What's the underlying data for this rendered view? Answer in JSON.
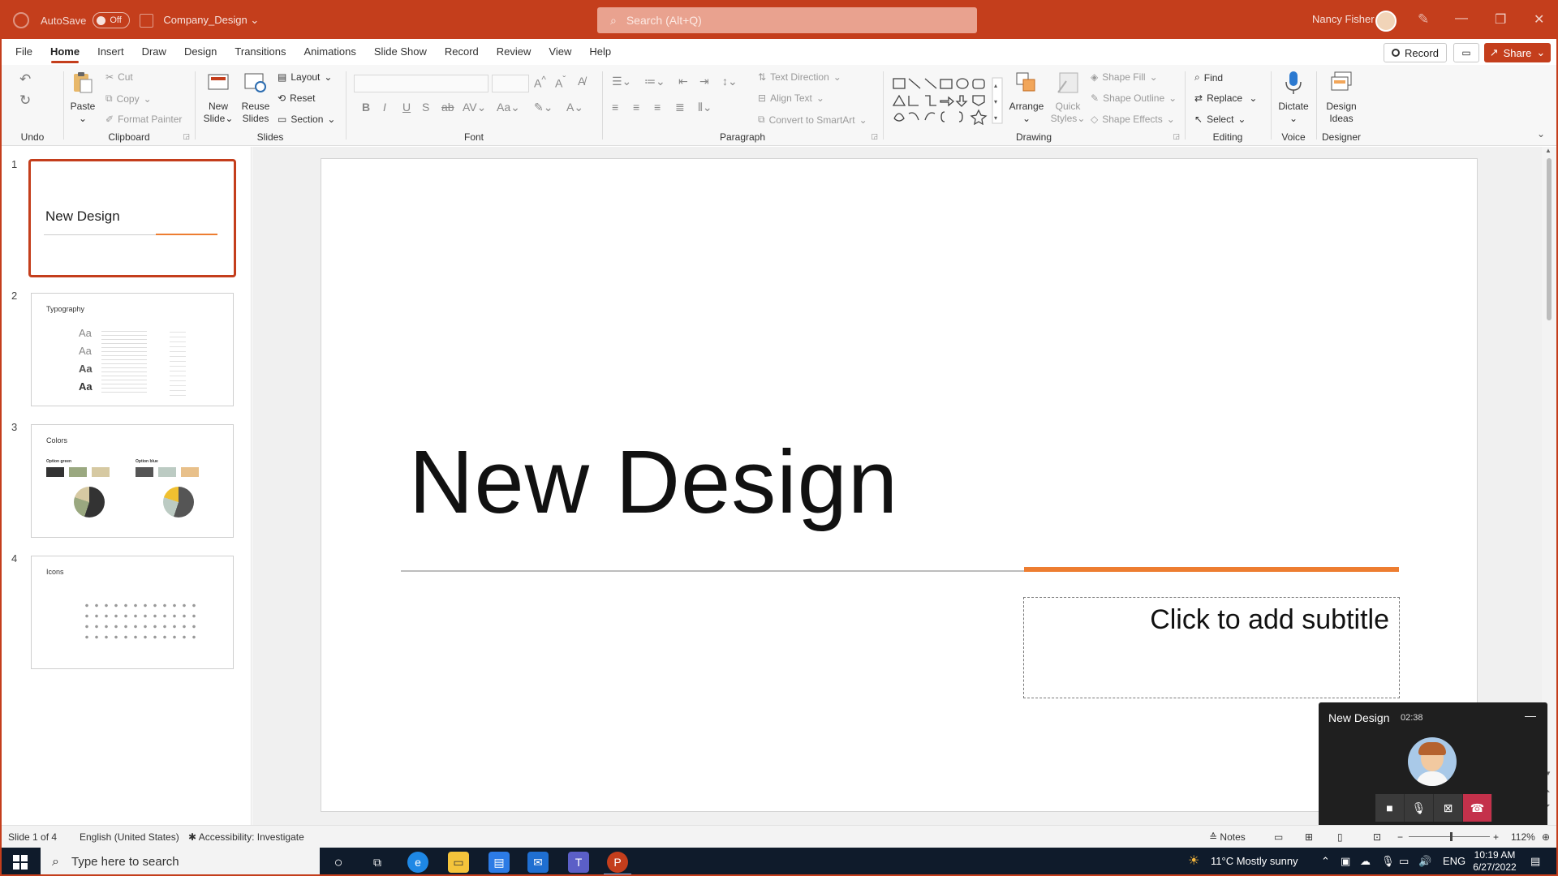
{
  "titlebar": {
    "autosave_label": "AutoSave",
    "autosave_state": "Off",
    "doc_name": "Company_Design",
    "search_placeholder": "Search (Alt+Q)",
    "user_name": "Nancy Fisher",
    "accent": "#c43e1c"
  },
  "menu": {
    "tabs": [
      "File",
      "Home",
      "Insert",
      "Draw",
      "Design",
      "Transitions",
      "Animations",
      "Slide Show",
      "Record",
      "Review",
      "View",
      "Help"
    ],
    "active": "Home",
    "record_label": "Record",
    "share_label": "Share"
  },
  "ribbon": {
    "undo": {
      "group": "Undo"
    },
    "clipboard": {
      "group": "Clipboard",
      "paste": "Paste",
      "cut": "Cut",
      "copy": "Copy",
      "format_painter": "Format Painter"
    },
    "slides": {
      "group": "Slides",
      "new_slide": "New Slide",
      "reuse_slides": "Reuse Slides",
      "layout": "Layout",
      "reset": "Reset",
      "section": "Section"
    },
    "font": {
      "group": "Font"
    },
    "paragraph": {
      "group": "Paragraph",
      "text_direction": "Text Direction",
      "align_text": "Align Text",
      "convert_smartart": "Convert to SmartArt"
    },
    "drawing": {
      "group": "Drawing",
      "arrange": "Arrange",
      "quick_styles": "Quick Styles",
      "shape_fill": "Shape Fill",
      "shape_outline": "Shape Outline",
      "shape_effects": "Shape Effects"
    },
    "editing": {
      "group": "Editing",
      "find": "Find",
      "replace": "Replace",
      "select": "Select"
    },
    "voice": {
      "group": "Voice",
      "dictate": "Dictate"
    },
    "designer": {
      "group": "Designer",
      "design_ideas": "Design Ideas"
    }
  },
  "thumbnails": [
    {
      "num": "1",
      "title": "New Design"
    },
    {
      "num": "2",
      "title": "Typography"
    },
    {
      "num": "3",
      "title": "Colors",
      "option_a": "Option green",
      "option_b": "Option blue"
    },
    {
      "num": "4",
      "title": "Icons"
    }
  ],
  "slide": {
    "title": "New Design",
    "subtitle_placeholder": "Click to add subtitle",
    "accent_color": "#ed7d31"
  },
  "call": {
    "title": "New Design",
    "time": "02:38"
  },
  "statusbar": {
    "slide_info": "Slide 1 of 4",
    "language": "English (United States)",
    "accessibility": "Accessibility: Investigate",
    "notes": "Notes",
    "zoom": "112%"
  },
  "taskbar": {
    "search_placeholder": "Type here to search",
    "weather": "11°C  Mostly sunny",
    "lang": "ENG",
    "time": "10:19 AM",
    "date": "6/27/2022"
  }
}
